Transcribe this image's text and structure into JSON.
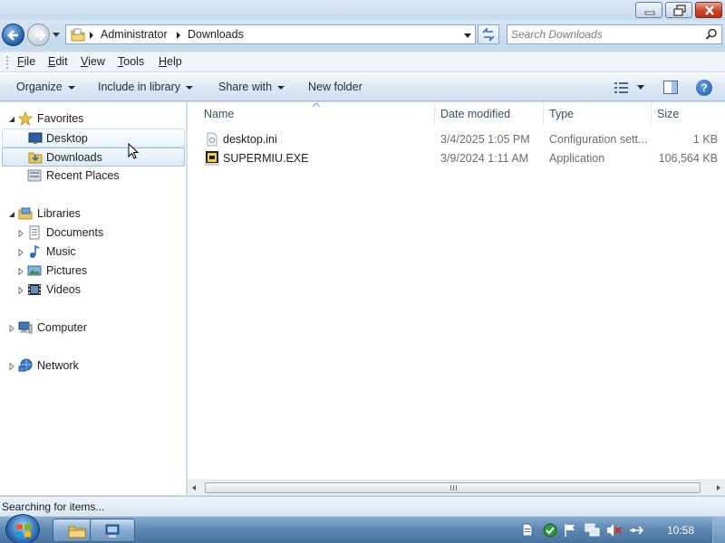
{
  "window": {
    "buttons": {
      "minimize": "minimize",
      "maximize": "restore",
      "close": "close"
    }
  },
  "address": {
    "crumbs": [
      "Administrator",
      "Downloads"
    ],
    "search_placeholder": "Search Downloads"
  },
  "menu": {
    "items": [
      "File",
      "Edit",
      "View",
      "Tools",
      "Help"
    ],
    "accel": [
      "F",
      "E",
      "V",
      "T",
      "H"
    ]
  },
  "commands": {
    "organize": "Organize",
    "include_in_library": "Include in library",
    "share_with": "Share with",
    "new_folder": "New folder",
    "help_glyph": "?"
  },
  "nav": {
    "favorites": "Favorites",
    "desktop": "Desktop",
    "downloads": "Downloads",
    "recent_places": "Recent Places",
    "libraries": "Libraries",
    "documents": "Documents",
    "music": "Music",
    "pictures": "Pictures",
    "videos": "Videos",
    "computer": "Computer",
    "network": "Network"
  },
  "columns": {
    "name": "Name",
    "date_modified": "Date modified",
    "type": "Type",
    "size": "Size"
  },
  "files": [
    {
      "name": "desktop.ini",
      "date": "3/4/2025 1:05 PM",
      "type": "Configuration sett...",
      "size": "1 KB",
      "icon": "ini-file-icon"
    },
    {
      "name": "SUPERMIU.EXE",
      "date": "3/9/2024 1:11 AM",
      "type": "Application",
      "size": "106,564 KB",
      "icon": "exe-file-icon"
    }
  ],
  "status": {
    "text": "Searching for items..."
  },
  "taskbar": {
    "clock": "10:58"
  },
  "colors": {
    "selection": "#dbeaf9",
    "accent": "#1d5ea8"
  }
}
